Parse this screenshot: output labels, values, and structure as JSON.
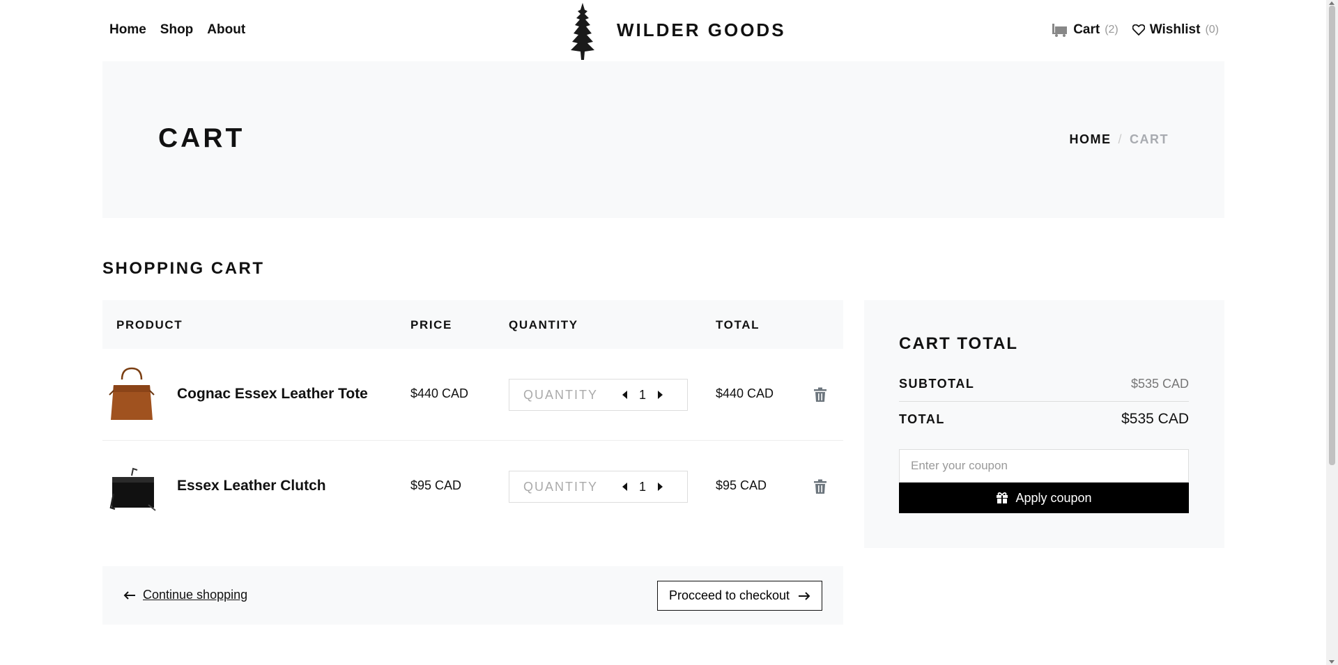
{
  "header": {
    "nav": [
      "Home",
      "Shop",
      "About"
    ],
    "brand": "WILDER GOODS",
    "cart_label": "Cart",
    "cart_count": "(2)",
    "wishlist_label": "Wishlist",
    "wishlist_count": "(0)"
  },
  "hero": {
    "title": "CART",
    "breadcrumb_home": "HOME",
    "breadcrumb_sep": "/",
    "breadcrumb_current": "CART"
  },
  "section_title": "SHOPPING CART",
  "table": {
    "headers": [
      "PRODUCT",
      "PRICE",
      "QUANTITY",
      "TOTAL"
    ],
    "items": [
      {
        "name": "Cognac Essex Leather Tote",
        "price": "$440 CAD",
        "qty_placeholder": "QUANTITY",
        "qty": "1",
        "total": "$440 CAD",
        "image_icon": "tote-bag-icon"
      },
      {
        "name": "Essex Leather Clutch",
        "price": "$95 CAD",
        "qty_placeholder": "QUANTITY",
        "qty": "1",
        "total": "$95 CAD",
        "image_icon": "clutch-bag-icon"
      }
    ]
  },
  "footer": {
    "continue_label": "Continue shopping",
    "checkout_label": "Procceed to checkout"
  },
  "totals": {
    "title": "CART TOTAL",
    "subtotal_label": "SUBTOTAL",
    "subtotal_value": "$535 CAD",
    "total_label": "TOTAL",
    "total_value": "$535 CAD",
    "coupon_placeholder": "Enter your coupon",
    "apply_label": "Apply coupon"
  }
}
